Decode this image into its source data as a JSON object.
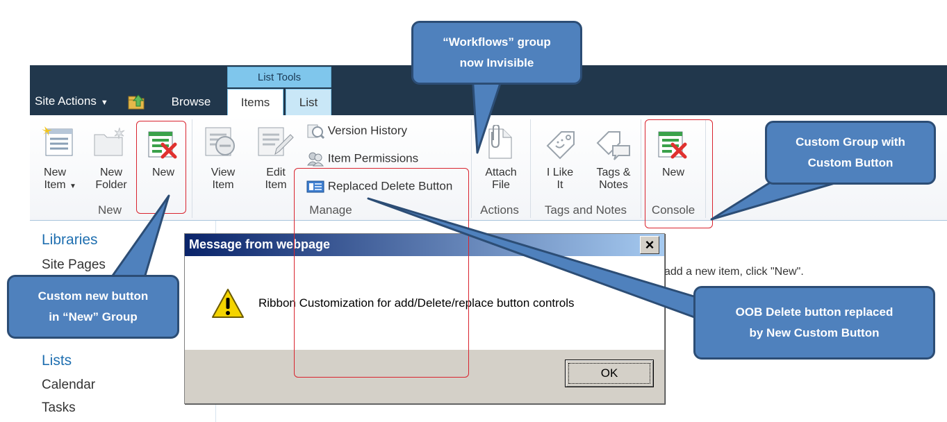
{
  "topbar": {
    "site_actions": "Site Actions",
    "contextual_group": "List Tools",
    "tabs": [
      "Browse",
      "Items",
      "List"
    ]
  },
  "ribbon": {
    "groups": {
      "new": {
        "label": "New",
        "buttons": [
          "New Item",
          "New Folder",
          "New"
        ]
      },
      "manage": {
        "label": "Manage",
        "large_buttons": [
          "View Item",
          "Edit Item"
        ],
        "small_buttons": [
          "Version History",
          "Item Permissions",
          "Replaced Delete Button"
        ]
      },
      "actions": {
        "label": "Actions",
        "buttons": [
          "Attach File"
        ]
      },
      "tags": {
        "label": "Tags and Notes",
        "buttons": [
          "I Like It",
          "Tags & Notes"
        ]
      },
      "console": {
        "label": "Console",
        "buttons": [
          "New"
        ]
      }
    }
  },
  "leftnav": {
    "libraries_heading": "Libraries",
    "libraries": [
      "Site Pages"
    ],
    "lists_heading": "Lists",
    "lists": [
      "Calendar",
      "Tasks"
    ]
  },
  "page": {
    "hint": "add a new item, click \"New\"."
  },
  "dialog": {
    "title": "Message from webpage",
    "message": "Ribbon Customization for add/Delete/replace button controls",
    "ok_label": "OK",
    "close_glyph": "×"
  },
  "callouts": {
    "workflows": [
      "“Workflows” group",
      "now Invisible"
    ],
    "custom_group": [
      "Custom Group with",
      "Custom Button"
    ],
    "custom_new": [
      "Custom new button",
      "in “New” Group"
    ],
    "oob_delete": [
      "OOB Delete button replaced",
      "by New Custom Button"
    ]
  },
  "colors": {
    "topbar": "#21374c",
    "contextual": "#7fc6ec",
    "callout_fill": "#4f81bd",
    "callout_border": "#2c4d75",
    "highlight": "#d9232e",
    "dialog_title": "#0a246a"
  }
}
